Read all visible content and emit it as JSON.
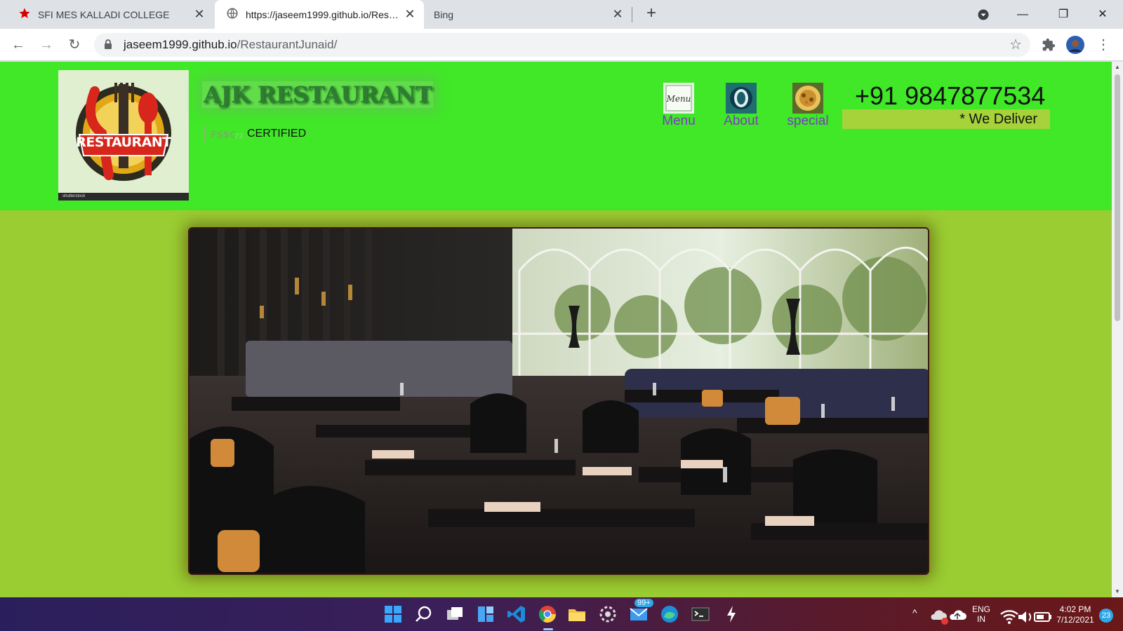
{
  "browser": {
    "tabs": [
      {
        "title": "SFI MES KALLADI COLLEGE",
        "icon": "red-star-icon"
      },
      {
        "title": "https://jaseem1999.github.io/Restau",
        "icon": "globe-icon"
      },
      {
        "title": "Bing",
        "icon": ""
      }
    ],
    "url_host": "jaseem1999.github.io",
    "url_path": "/RestaurantJunaid/"
  },
  "site": {
    "brand": "AJK RESTAURANT",
    "logo_text": "RESTAURANT",
    "logo_watermark": "shutterstock",
    "cert_logo_text": "FSSC",
    "certified": "CERTIFIED",
    "nav": [
      {
        "label": "Menu",
        "icon": "menu-card-icon"
      },
      {
        "label": "About",
        "icon": "about-circle-icon"
      },
      {
        "label": "special",
        "icon": "special-dish-icon"
      }
    ],
    "phone": "+91 9847877534",
    "tagline": "* We Deliver"
  },
  "taskbar": {
    "mail_badge": "99+",
    "lang": "ENG",
    "region": "IN",
    "time": "4:02 PM",
    "date": "7/12/2021",
    "notif_count": "23"
  },
  "colors": {
    "header_bg": "#40e827",
    "page_bg": "#9acd32",
    "nav_text": "#7b3cc1"
  }
}
